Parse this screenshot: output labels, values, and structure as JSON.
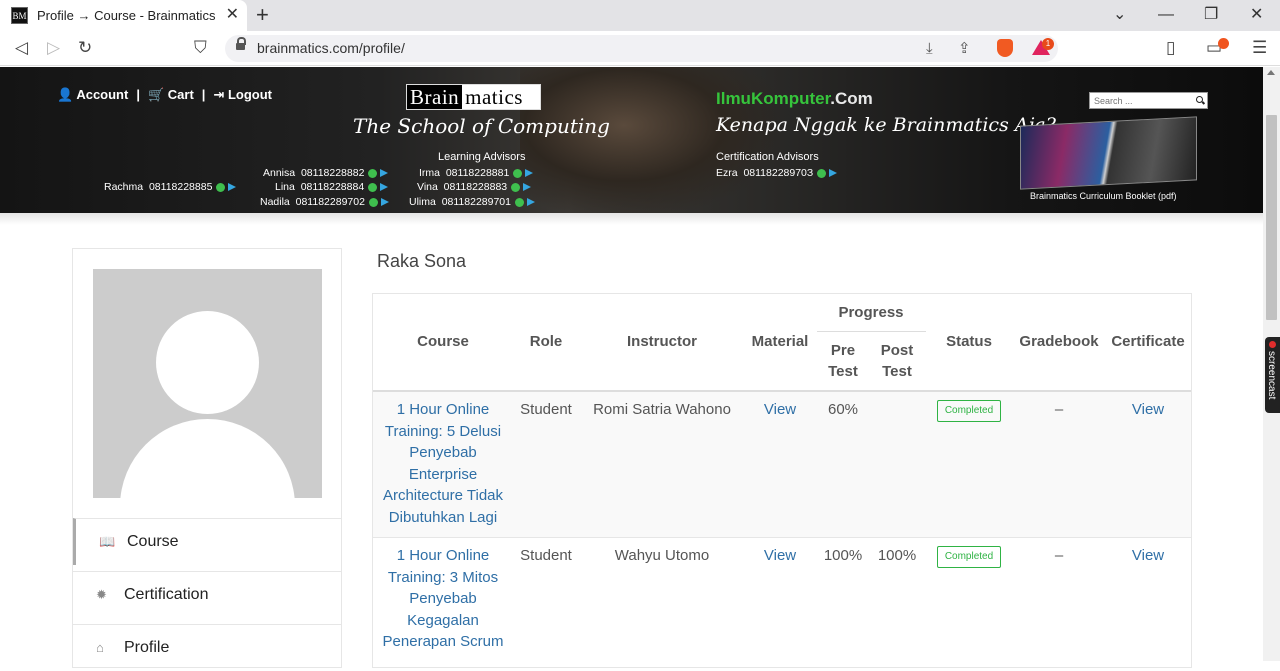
{
  "browser": {
    "tab_title": "Profile → Course - Brainmatics",
    "favicon_text": "BM",
    "url": "brainmatics.com/profile/",
    "bat_badge": "1"
  },
  "banner": {
    "account_label": "Account",
    "cart_label": "Cart",
    "logout_label": "Logout",
    "separator": "|",
    "logo_part1": "Brain",
    "logo_part2": "matics",
    "tagline": "The School of Computing",
    "advisors_title": "Learning Advisors",
    "advisors": [
      {
        "name": "Annisa",
        "phone": "08118228882"
      },
      {
        "name": "Irma",
        "phone": "08118228881"
      },
      {
        "name": "Rachma",
        "phone": "08118228885"
      },
      {
        "name": "Lina",
        "phone": "08118228884"
      },
      {
        "name": "Vina",
        "phone": "08118228883"
      },
      {
        "name": "Nadila",
        "phone": "081182289702"
      },
      {
        "name": "Ulima",
        "phone": "081182289701"
      }
    ],
    "ik_logo_main": "IlmuKomputer",
    "ik_logo_suffix": ".Com",
    "ik_tagline": "Kenapa Nggak ke Brainmatics Aja?",
    "cert_title": "Certification Advisors",
    "cert_advisor": {
      "name": "Ezra",
      "phone": "08118228970З"
    },
    "search_placeholder": "Search ...",
    "booklet_caption": "Brainmatics Curriculum Booklet (pdf)"
  },
  "screencast_label": "screencast",
  "sidebar": {
    "items": [
      {
        "label": "Course",
        "icon": "book-icon"
      },
      {
        "label": "Certification",
        "icon": "certificate-icon"
      },
      {
        "label": "Profile",
        "icon": "home-icon"
      }
    ]
  },
  "main": {
    "user_name": "Raka Sona",
    "headers": {
      "course": "Course",
      "role": "Role",
      "instructor": "Instructor",
      "material": "Material",
      "progress": "Progress",
      "pre_test_1": "Pre",
      "pre_test_2": "Test",
      "post_test_1": "Post",
      "post_test_2": "Test",
      "status": "Status",
      "gradebook": "Gradebook",
      "certificate": "Certificate"
    },
    "rows": [
      {
        "course_lines": [
          "1 Hour Online",
          "Training: 5 Delusi",
          "Penyebab",
          "Enterprise",
          "Architecture Tidak",
          "Dibutuhkan Lagi"
        ],
        "role": "Student",
        "instructor": "Romi Satria Wahono",
        "material": "View",
        "pre_test": "60%",
        "post_test": "",
        "status": "Completed",
        "gradebook": "–",
        "certificate": "View"
      },
      {
        "course_lines": [
          "1 Hour Online",
          "Training: 3 Mitos",
          "Penyebab",
          "Kegagalan",
          "Penerapan Scrum"
        ],
        "role": "Student",
        "instructor": "Wahyu Utomo",
        "material": "View",
        "pre_test": "100%",
        "post_test": "100%",
        "status": "Completed",
        "gradebook": "–",
        "certificate": "View"
      }
    ]
  }
}
